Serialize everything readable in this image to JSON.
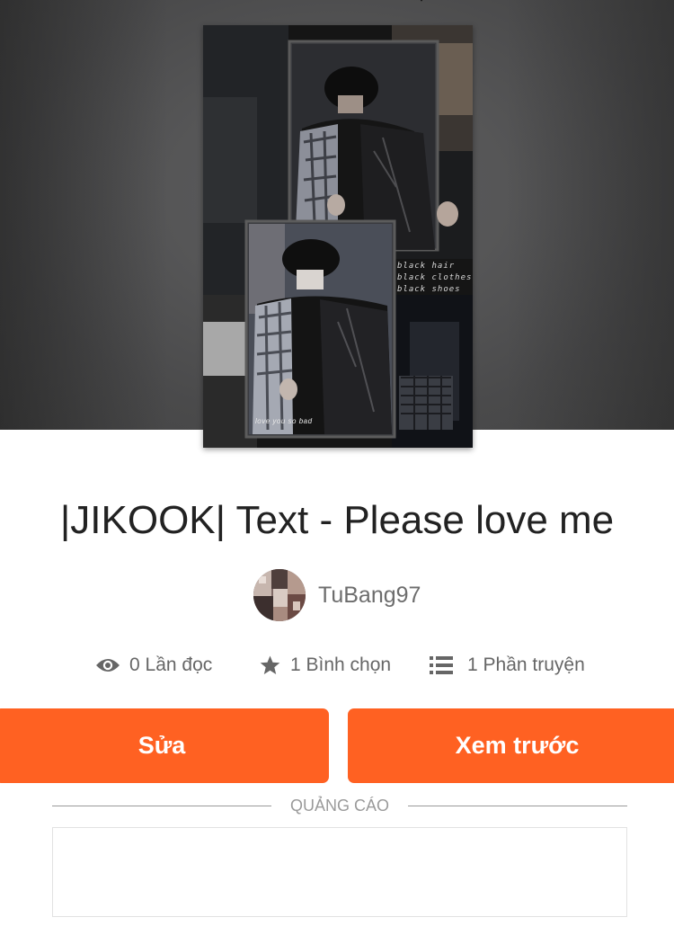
{
  "story": {
    "title": "|JIKOOK| Text - Please love me",
    "author": "TuBang97",
    "cover_caption": [
      "black hair",
      "black clothes",
      "black shoes"
    ],
    "cover_tag": "love you so bad"
  },
  "stats": {
    "reads": "0 Lần đọc",
    "votes": "1 Bình chọn",
    "parts": "1 Phần truyện",
    "icons": [
      "eye-icon",
      "star-icon",
      "list-icon"
    ]
  },
  "actions": {
    "edit_label": "Sửa",
    "preview_label": "Xem trước"
  },
  "ad": {
    "label": "QUẢNG CÁO"
  },
  "colors": {
    "accent": "#ff6122",
    "hero_bg": "#565657",
    "title_text": "#222222",
    "muted_text": "#666666"
  }
}
